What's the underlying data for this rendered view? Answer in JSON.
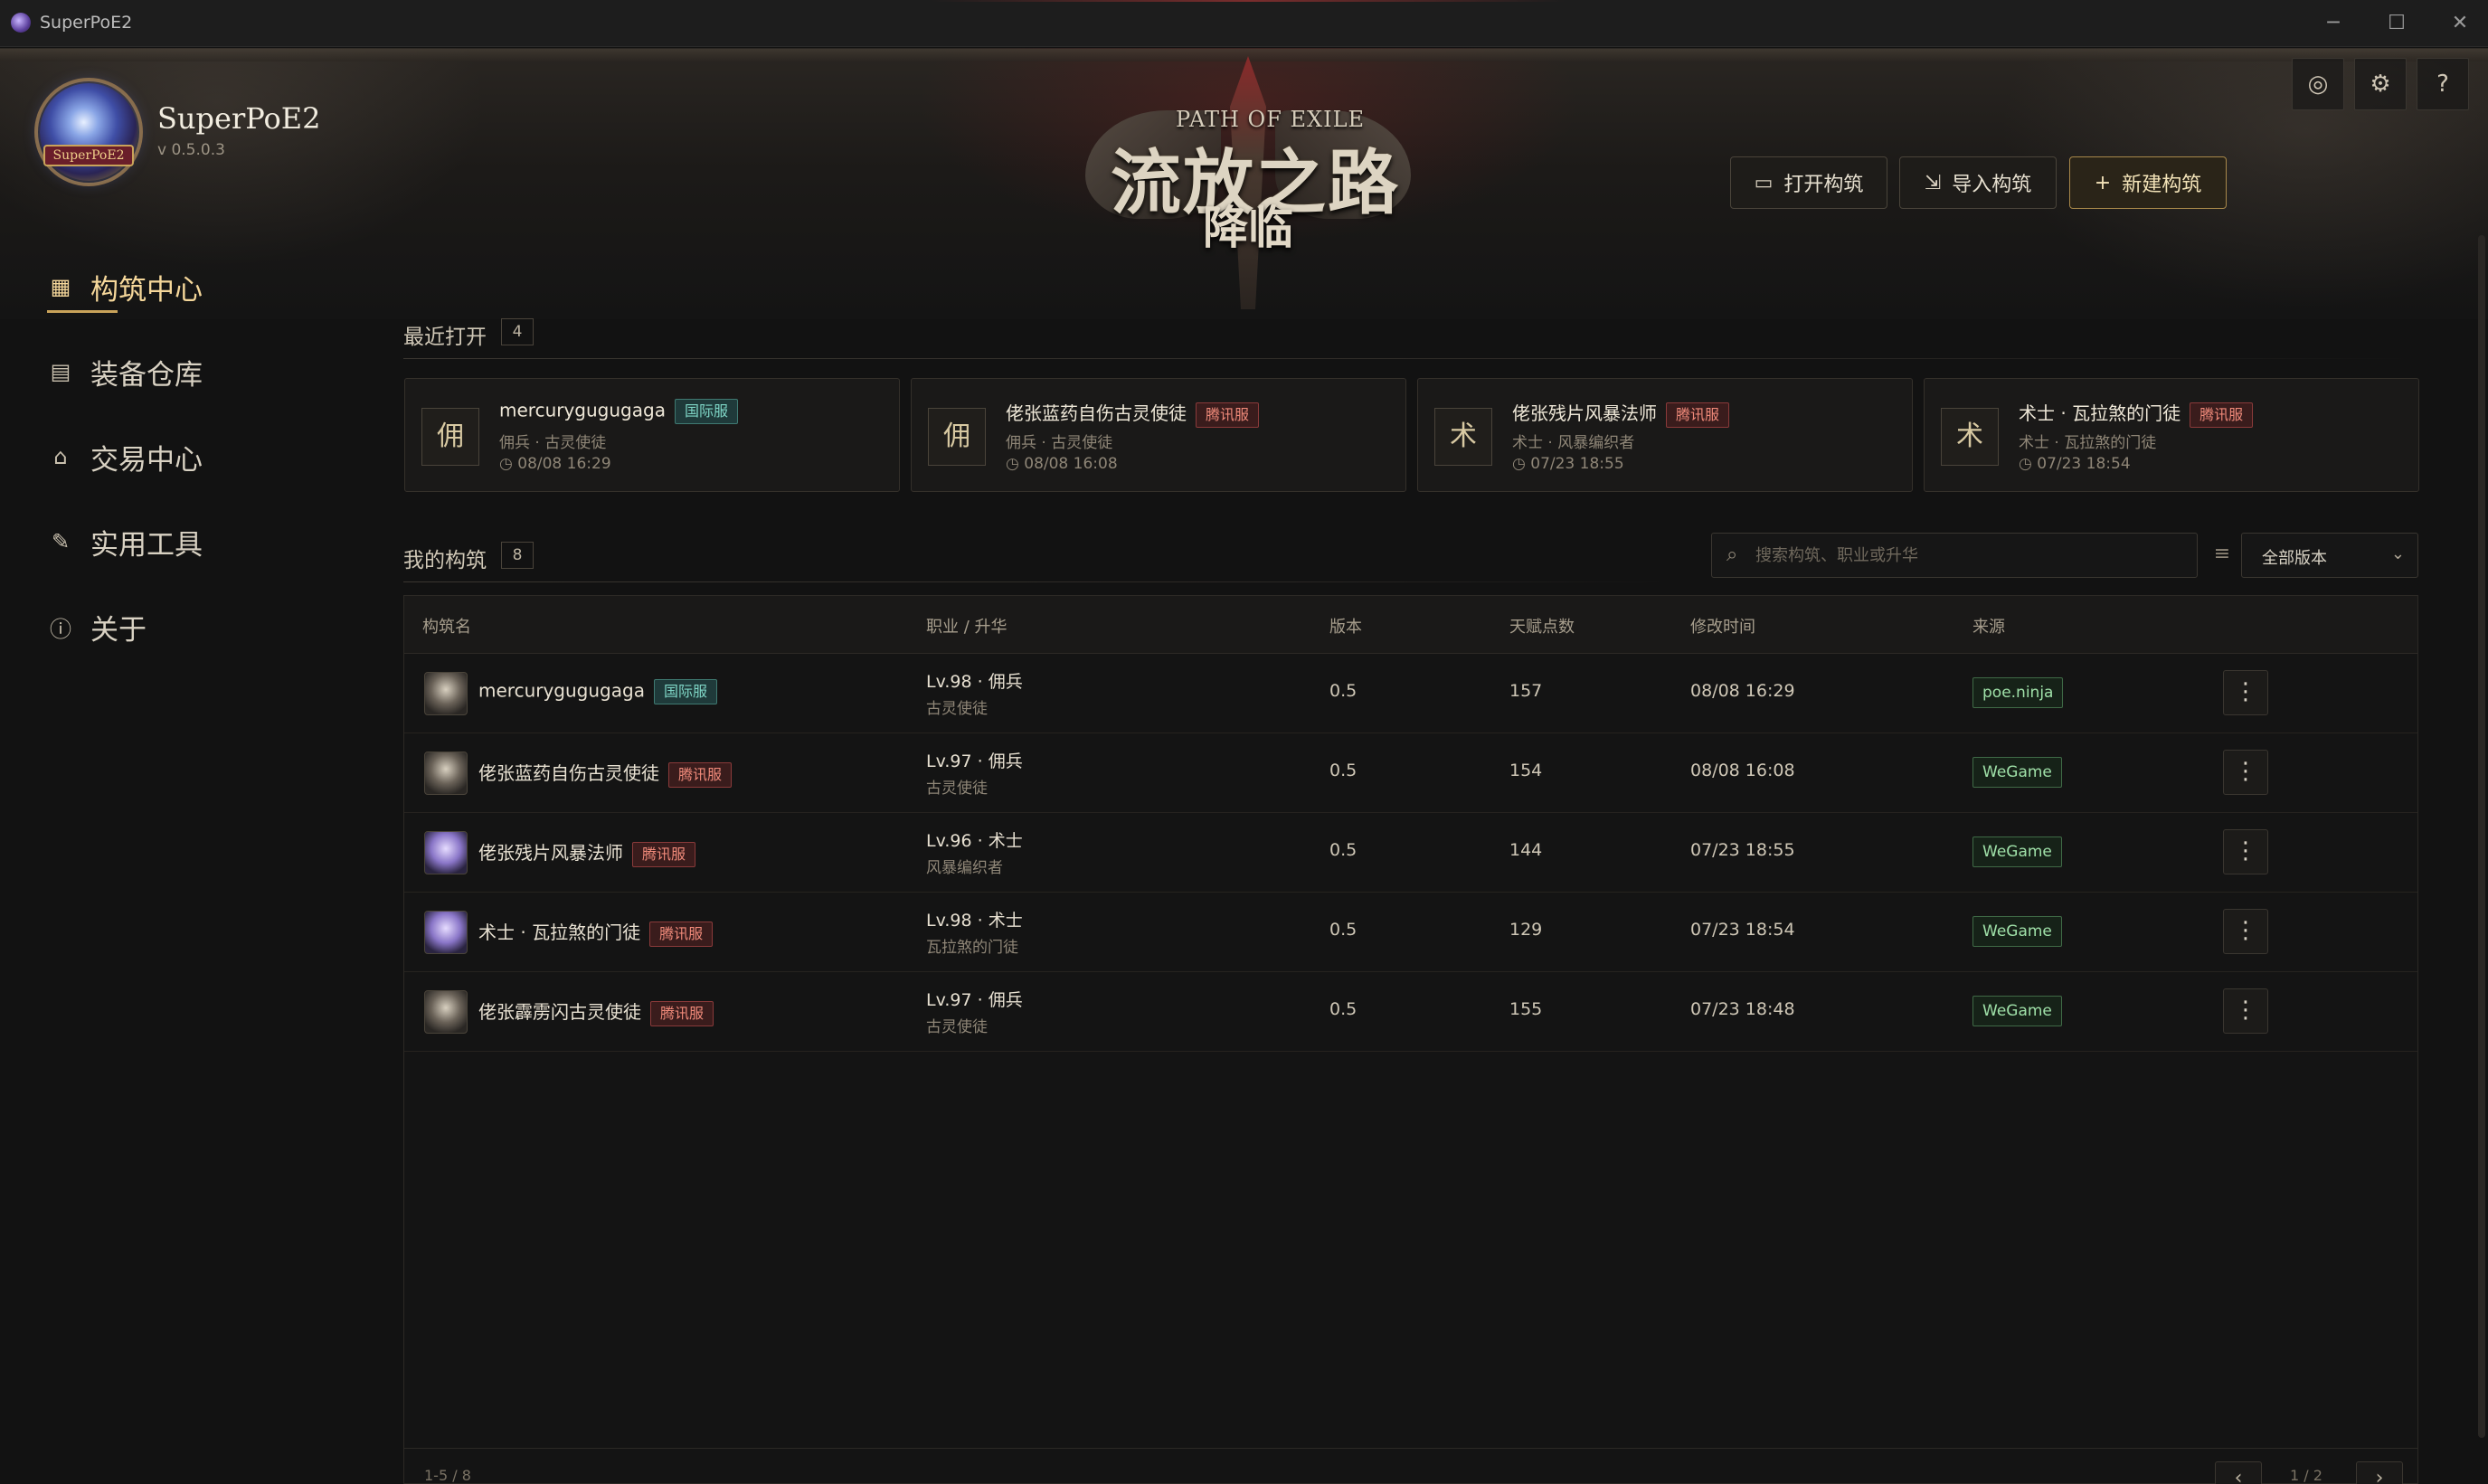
{
  "window": {
    "title": "SuperPoE2",
    "controls": {
      "minimize": "─",
      "maximize": "☐",
      "close": "✕"
    }
  },
  "brand": {
    "name": "SuperPoE2",
    "version": "v 0.5.0.3",
    "banner": "SuperPoE2"
  },
  "game_logo": {
    "english": "PATH OF EXILE",
    "chinese": "流放之路",
    "subtitle": "降临"
  },
  "header_icons": [
    {
      "name": "capture-icon",
      "glyph": "◎"
    },
    {
      "name": "gear-icon",
      "glyph": "⚙"
    },
    {
      "name": "help-icon",
      "glyph": "?"
    }
  ],
  "actions": {
    "open_label": "打开构筑",
    "import_label": "导入构筑",
    "new_label": "新建构筑"
  },
  "sidebar": {
    "items": [
      {
        "label": "构筑中心",
        "icon": "grid-icon",
        "glyph": "▦",
        "active": true
      },
      {
        "label": "装备仓库",
        "icon": "box-icon",
        "glyph": "▤",
        "active": false
      },
      {
        "label": "交易中心",
        "icon": "store-icon",
        "glyph": "⌂",
        "active": false
      },
      {
        "label": "实用工具",
        "icon": "wrench-icon",
        "glyph": "✎",
        "active": false
      },
      {
        "label": "关于",
        "icon": "info-icon",
        "glyph": "ⓘ",
        "active": false
      }
    ]
  },
  "recent": {
    "title": "最近打开",
    "count": "4",
    "cards": [
      {
        "glyph": "佣",
        "name": "mercurygugugaga",
        "badge": "国际服",
        "badge_type": "intl",
        "meta": "佣兵 · 古灵使徒",
        "time": "08/08 16:29"
      },
      {
        "glyph": "佣",
        "name": "佬张蓝药自伤古灵使徒",
        "badge": "腾讯服",
        "badge_type": "tx",
        "meta": "佣兵 · 古灵使徒",
        "time": "08/08 16:08"
      },
      {
        "glyph": "术",
        "name": "佬张残片风暴法师",
        "badge": "腾讯服",
        "badge_type": "tx",
        "meta": "术士 · 风暴编织者",
        "time": "07/23 18:55"
      },
      {
        "glyph": "术",
        "name": "术士 · 瓦拉煞的门徒",
        "badge": "腾讯服",
        "badge_type": "tx",
        "meta": "术士 · 瓦拉煞的门徒",
        "time": "07/23 18:54"
      }
    ]
  },
  "builds": {
    "title": "我的构筑",
    "count": "8",
    "search_placeholder": "搜索构筑、职业或升华",
    "version_filter": "全部版本",
    "columns": {
      "name": "构筑名",
      "class": "职业 / 升华",
      "version": "版本",
      "points": "天赋点数",
      "modified": "修改时间",
      "source": "来源"
    },
    "rows": [
      {
        "name": "mercurygugugaga",
        "badge": "国际服",
        "badge_type": "intl",
        "level": "Lv.98 · 佣兵",
        "ascendancy": "古灵使徒",
        "version": "0.5",
        "points": "157",
        "modified": "08/08 16:29",
        "source": "poe.ninja",
        "avatar": "grey"
      },
      {
        "name": "佬张蓝药自伤古灵使徒",
        "badge": "腾讯服",
        "badge_type": "tx",
        "level": "Lv.97 · 佣兵",
        "ascendancy": "古灵使徒",
        "version": "0.5",
        "points": "154",
        "modified": "08/08 16:08",
        "source": "WeGame",
        "avatar": "grey"
      },
      {
        "name": "佬张残片风暴法师",
        "badge": "腾讯服",
        "badge_type": "tx",
        "level": "Lv.96 · 术士",
        "ascendancy": "风暴编织者",
        "version": "0.5",
        "points": "144",
        "modified": "07/23 18:55",
        "source": "WeGame",
        "avatar": "purple"
      },
      {
        "name": "术士 · 瓦拉煞的门徒",
        "badge": "腾讯服",
        "badge_type": "tx",
        "level": "Lv.98 · 术士",
        "ascendancy": "瓦拉煞的门徒",
        "version": "0.5",
        "points": "129",
        "modified": "07/23 18:54",
        "source": "WeGame",
        "avatar": "purple"
      },
      {
        "name": "佬张霹雳闪古灵使徒",
        "badge": "腾讯服",
        "badge_type": "tx",
        "level": "Lv.97 · 佣兵",
        "ascendancy": "古灵使徒",
        "version": "0.5",
        "points": "155",
        "modified": "07/23 18:48",
        "source": "WeGame",
        "avatar": "grey"
      }
    ],
    "range": "1-5 / 8",
    "page": "1 / 2",
    "prev": "‹",
    "next": "›"
  },
  "colors": {
    "accent_gold": "#c9a35a",
    "intl_badge": "#7fd6c6",
    "tx_badge": "#f08a7a",
    "source_badge": "#9fe0a8",
    "background": "#121212"
  }
}
